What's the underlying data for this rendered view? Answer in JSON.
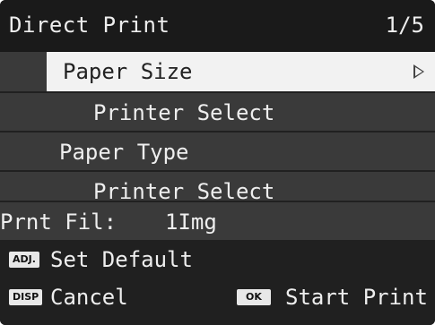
{
  "header": {
    "title": "Direct Print",
    "page": "1/5"
  },
  "menu": {
    "paper_size": {
      "label": "Paper Size",
      "value": "Printer Select"
    },
    "paper_type": {
      "label": "Paper Type",
      "value": "Printer Select"
    },
    "print_file": {
      "label": "Prnt Fil:",
      "value": "1Img"
    }
  },
  "footer": {
    "set_default": {
      "badge": "ADJ.",
      "label": "Set Default"
    },
    "cancel": {
      "badge": "DISP",
      "label": "Cancel"
    },
    "start_print": {
      "badge": "OK",
      "label": "Start Print"
    }
  },
  "icons": {
    "submenu": "chevron-right-icon",
    "scroll": "scroll-down-icon"
  },
  "colors": {
    "background": "#121212",
    "row": "#3a3a3a",
    "selected": "#f2f2f2",
    "text": "#eeeeee"
  }
}
